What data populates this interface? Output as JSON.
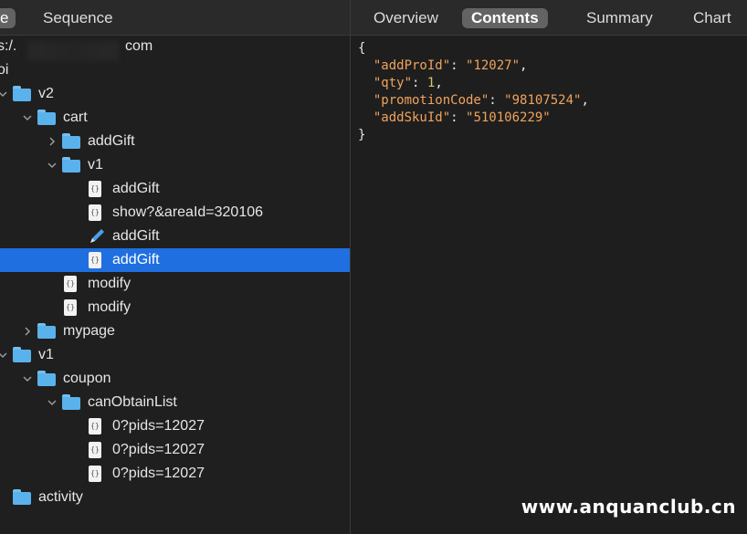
{
  "left_tabs": [
    {
      "label": "e",
      "active": true
    },
    {
      "label": "Sequence",
      "active": false
    }
  ],
  "right_tabs": [
    {
      "label": "Overview",
      "active": false
    },
    {
      "label": "Contents",
      "active": true
    },
    {
      "label": "Summary",
      "active": false
    },
    {
      "label": "Chart",
      "active": false
    }
  ],
  "tree": {
    "host_prefix": "s:/.",
    "host_suffix": "com",
    "rows": [
      {
        "label": "oi",
        "icon": "none",
        "chevron": "none",
        "depth": 0
      },
      {
        "label": "v2",
        "icon": "folder",
        "chevron": "down",
        "depth": 1
      },
      {
        "label": "cart",
        "icon": "folder",
        "chevron": "down",
        "depth": 2
      },
      {
        "label": "addGift",
        "icon": "folder",
        "chevron": "right",
        "depth": 3
      },
      {
        "label": "v1",
        "icon": "folder",
        "chevron": "down",
        "depth": 3
      },
      {
        "label": "addGift",
        "icon": "json-file",
        "chevron": "none",
        "depth": 4
      },
      {
        "label": "show?&areaId=320106",
        "icon": "json-file",
        "chevron": "none",
        "depth": 4
      },
      {
        "label": "addGift",
        "icon": "pencil-edit",
        "chevron": "none",
        "depth": 4
      },
      {
        "label": "addGift",
        "icon": "json-file",
        "chevron": "none",
        "depth": 4,
        "selected": true
      },
      {
        "label": "modify",
        "icon": "json-file",
        "chevron": "none",
        "depth": 3
      },
      {
        "label": "modify",
        "icon": "json-file",
        "chevron": "none",
        "depth": 3
      },
      {
        "label": "mypage",
        "icon": "folder",
        "chevron": "right",
        "depth": 2
      },
      {
        "label": "v1",
        "icon": "folder",
        "chevron": "down",
        "depth": 1
      },
      {
        "label": "coupon",
        "icon": "folder",
        "chevron": "down",
        "depth": 2
      },
      {
        "label": "canObtainList",
        "icon": "folder",
        "chevron": "down",
        "depth": 3
      },
      {
        "label": "0?pids=12027",
        "icon": "json-file",
        "chevron": "none",
        "depth": 4
      },
      {
        "label": "0?pids=12027",
        "icon": "json-file",
        "chevron": "none",
        "depth": 4
      },
      {
        "label": "0?pids=12027",
        "icon": "json-file",
        "chevron": "none",
        "depth": 4
      },
      {
        "label": "activity",
        "icon": "folder",
        "chevron": "none",
        "depth": 1
      }
    ]
  },
  "json_body": {
    "open": "{",
    "close": "}",
    "entries": [
      {
        "key": "\"addProId\"",
        "value": "\"12027\"",
        "type": "string",
        "comma": ","
      },
      {
        "key": "\"qty\"",
        "value": "1",
        "type": "number",
        "comma": ","
      },
      {
        "key": "\"promotionCode\"",
        "value": "\"98107524\"",
        "type": "string",
        "comma": ","
      },
      {
        "key": "\"addSkuId\"",
        "value": "\"510106229\"",
        "type": "string",
        "comma": ""
      }
    ]
  },
  "watermark": "www.anquanclub.cn",
  "colors": {
    "selection": "#1f6fe0",
    "folder": "#5ab2ec",
    "json_key": "#f0a35c",
    "json_number": "#d8c76a"
  }
}
